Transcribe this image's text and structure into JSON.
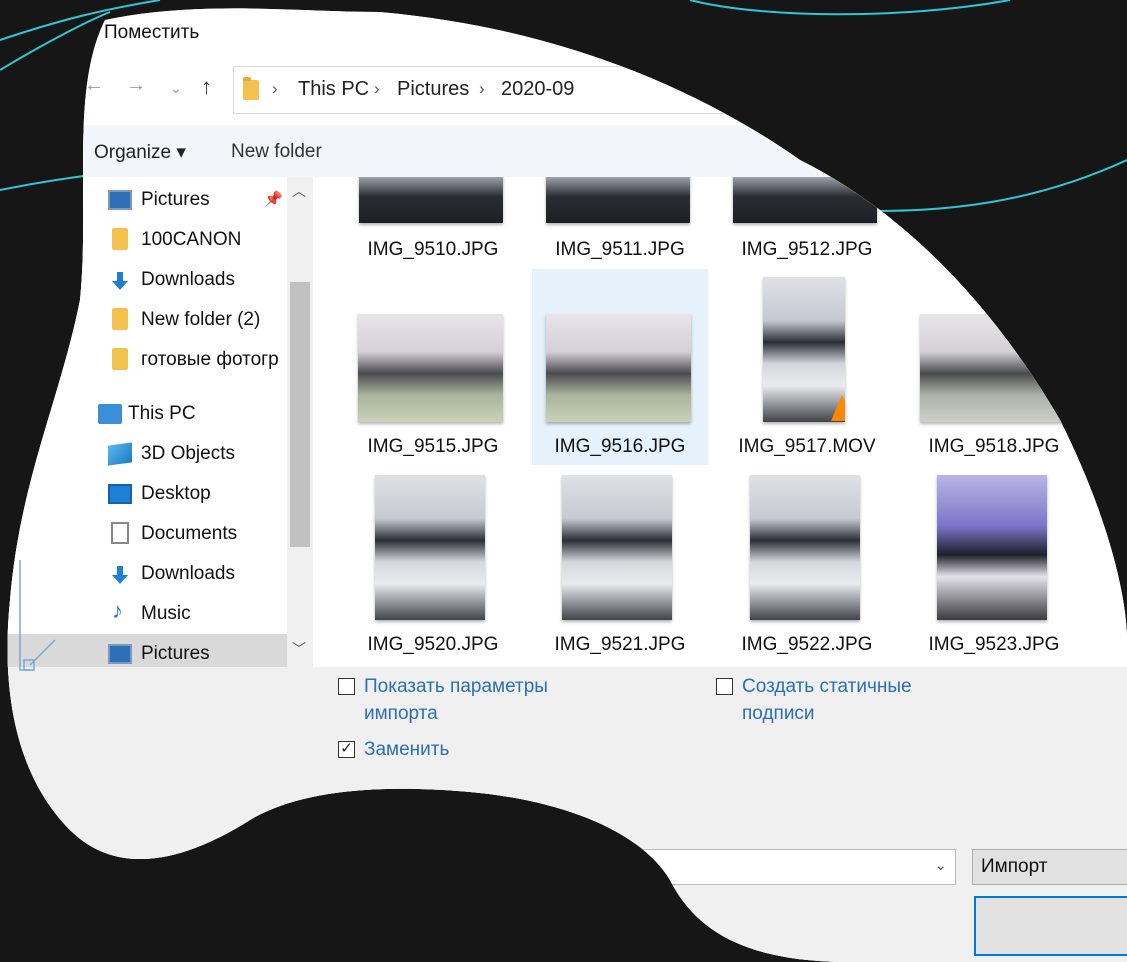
{
  "window": {
    "title": "Поместить"
  },
  "address": {
    "crumbs": [
      "This PC",
      "Pictures",
      "2020-09"
    ],
    "back_glyph": "←",
    "forward_glyph": "→",
    "recent_glyph": "⌄",
    "up_glyph": "↑"
  },
  "toolbar": {
    "organize": "Organize ▾",
    "new_folder": "New folder"
  },
  "nav": {
    "items": [
      {
        "label": "Pictures",
        "icon": "pictures-icon",
        "pinned": true
      },
      {
        "label": "100CANON",
        "icon": "folder-icon"
      },
      {
        "label": "Downloads",
        "icon": "download-icon"
      },
      {
        "label": "New folder (2)",
        "icon": "folder-icon"
      },
      {
        "label": "готовые фотогр",
        "icon": "folder-icon"
      },
      {
        "label": "This PC",
        "icon": "computer-icon"
      },
      {
        "label": "3D Objects",
        "icon": "3d-objects-icon"
      },
      {
        "label": "Desktop",
        "icon": "desktop-icon"
      },
      {
        "label": "Documents",
        "icon": "documents-icon"
      },
      {
        "label": "Downloads",
        "icon": "download-icon"
      },
      {
        "label": "Music",
        "icon": "music-icon"
      },
      {
        "label": "Pictures",
        "icon": "pictures-icon",
        "selected": true
      }
    ]
  },
  "files": [
    {
      "name": "IMG_9510.JPG"
    },
    {
      "name": "IMG_9511.JPG"
    },
    {
      "name": "IMG_9512.JPG"
    },
    {
      "name": "IMG_9515.JPG"
    },
    {
      "name": "IMG_9516.JPG",
      "selected": true
    },
    {
      "name": "IMG_9517.MOV",
      "video": true
    },
    {
      "name": "IMG_9518.JPG"
    },
    {
      "name": "IMG_9520.JPG"
    },
    {
      "name": "IMG_9521.JPG"
    },
    {
      "name": "IMG_9522.JPG"
    },
    {
      "name": "IMG_9523.JPG"
    }
  ],
  "options": {
    "show_import_options": {
      "label_line1": "Показать параметры",
      "label_line2": "импорта",
      "checked": false
    },
    "create_static_captions": {
      "label_line1": "Создать статичные",
      "label_line2": "подписи",
      "checked": false
    },
    "replace": {
      "label": "Заменить",
      "checked": true,
      "check_glyph": "✓"
    }
  },
  "actions": {
    "import": "Импорт"
  },
  "colors": {
    "accent": "#0078d7",
    "link": "#2a6fb5",
    "selection": "#e5f1fb",
    "backdrop": "#161616",
    "line": "#2fc6d6"
  }
}
